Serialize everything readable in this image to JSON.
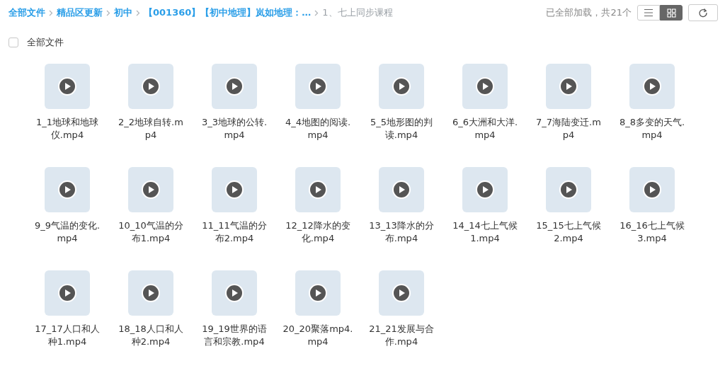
{
  "breadcrumb": [
    {
      "label": "全部文件",
      "link": true
    },
    {
      "label": "精品区更新",
      "link": true
    },
    {
      "label": "初中",
      "link": true
    },
    {
      "label": "【001360】【初中地理】岚如地理：…",
      "link": true
    },
    {
      "label": "1、七上同步课程",
      "link": false
    }
  ],
  "status": "已全部加载，共21个",
  "view_modes": [
    {
      "kind": "list",
      "selected": false
    },
    {
      "kind": "grid",
      "selected": true
    }
  ],
  "select_all": {
    "label": "全部文件",
    "checked": false
  },
  "files": [
    {
      "name": "1_1地球和地球仪.mp4"
    },
    {
      "name": "2_2地球自转.mp4"
    },
    {
      "name": "3_3地球的公转.mp4"
    },
    {
      "name": "4_4地图的阅读.mp4"
    },
    {
      "name": "5_5地形图的判读.mp4"
    },
    {
      "name": "6_6大洲和大洋.mp4"
    },
    {
      "name": "7_7海陆变迁.mp4"
    },
    {
      "name": "8_8多变的天气.mp4"
    },
    {
      "name": "9_9气温的变化.mp4"
    },
    {
      "name": "10_10气温的分布1.mp4"
    },
    {
      "name": "11_11气温的分布2.mp4"
    },
    {
      "name": "12_12降水的变化.mp4"
    },
    {
      "name": "13_13降水的分布.mp4"
    },
    {
      "name": "14_14七上气候1.mp4"
    },
    {
      "name": "15_15七上气候2.mp4"
    },
    {
      "name": "16_16七上气候3.mp4"
    },
    {
      "name": "17_17人口和人种1.mp4"
    },
    {
      "name": "18_18人口和人种2.mp4"
    },
    {
      "name": "19_19世界的语言和宗教.mp4"
    },
    {
      "name": "20_20聚落mp4.mp4"
    },
    {
      "name": "21_21发展与合作.mp4"
    }
  ]
}
